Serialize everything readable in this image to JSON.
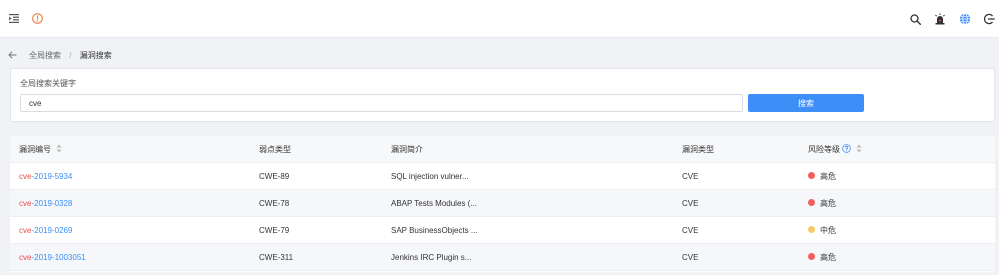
{
  "topbar": {
    "icons": [
      "menu-fold-icon",
      "info-icon",
      "search-icon",
      "alarm-icon",
      "globe-icon",
      "logout-icon"
    ]
  },
  "breadcrumb": {
    "items": [
      "全局搜索",
      "漏洞搜索"
    ],
    "separator": "/"
  },
  "search": {
    "label": "全局搜索关键字",
    "value": "cve",
    "button_label": "搜索"
  },
  "table": {
    "headers": {
      "id": "漏洞编号",
      "weakness_type": "弱点类型",
      "summary": "漏洞简介",
      "vuln_type": "漏洞类型",
      "risk_level": "风险等级"
    },
    "rows": [
      {
        "id_prefix": "cve",
        "id_rest": "-2019-5934",
        "weakness_type": "CWE-89",
        "summary": "SQL injection vulner...",
        "vuln_type": "CVE",
        "risk_level": "高危",
        "risk_color": "#f25e5e"
      },
      {
        "id_prefix": "cve",
        "id_rest": "-2019-0328",
        "weakness_type": "CWE-78",
        "summary": "ABAP Tests Modules (...",
        "vuln_type": "CVE",
        "risk_level": "高危",
        "risk_color": "#f25e5e"
      },
      {
        "id_prefix": "cve",
        "id_rest": "-2019-0269",
        "weakness_type": "CWE-79",
        "summary": "SAP BusinessObjects ...",
        "vuln_type": "CVE",
        "risk_level": "中危",
        "risk_color": "#f5c969"
      },
      {
        "id_prefix": "cve",
        "id_rest": "-2019-1003051",
        "weakness_type": "CWE-311",
        "summary": "Jenkins IRC Plugin s...",
        "vuln_type": "CVE",
        "risk_level": "高危",
        "risk_color": "#f25e5e"
      }
    ]
  },
  "colors": {
    "accent": "#3e8ef7",
    "cve_prefix": "#e8504a",
    "info_icon": "#f07b3f",
    "risk_high": "#f25e5e",
    "risk_medium": "#f5c969"
  }
}
